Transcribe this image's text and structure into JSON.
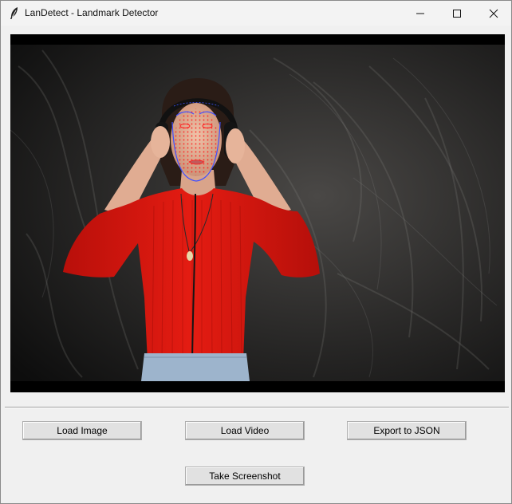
{
  "window": {
    "title": "LanDetect - Landmark Detector",
    "icon": "feather-icon",
    "controls": [
      "minimize-icon",
      "maximize-icon",
      "close-icon"
    ]
  },
  "preview": {
    "content": "video-frame-with-face-landmarks",
    "landmark_color": "#ff2020",
    "contour_color": "#4050ff"
  },
  "buttons": {
    "load_image": "Load Image",
    "load_video": "Load Video",
    "export_json": "Export to JSON",
    "take_screenshot": "Take Screenshot"
  }
}
